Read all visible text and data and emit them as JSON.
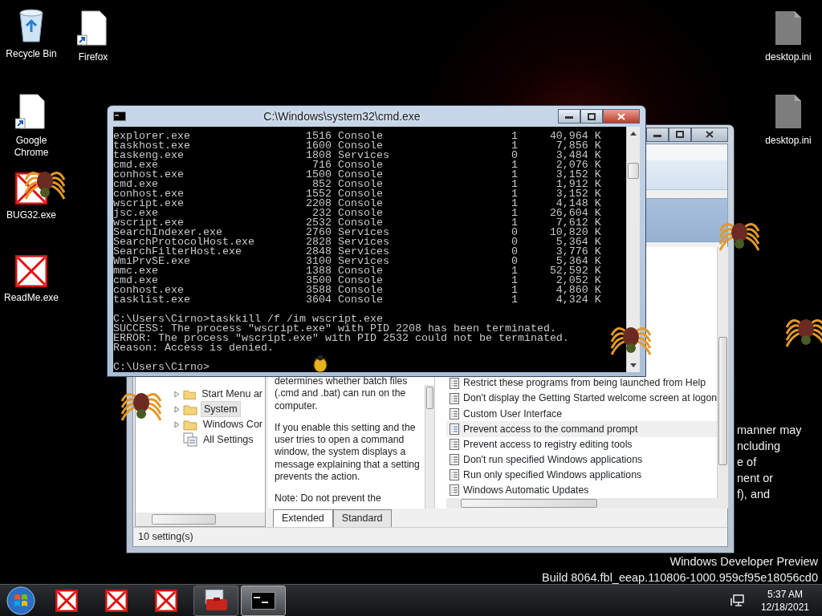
{
  "desktop_icons": [
    {
      "label": "Recycle Bin",
      "kind": "recycle"
    },
    {
      "label": "Firefox",
      "kind": "shortcut"
    },
    {
      "label": "Google Chrome",
      "kind": "shortcut"
    },
    {
      "label": "BUG32.exe",
      "kind": "denied"
    },
    {
      "label": "ReadMe.exe",
      "kind": "denied"
    },
    {
      "label": "desktop.ini",
      "kind": "file"
    },
    {
      "label": "desktop.ini",
      "kind": "file"
    }
  ],
  "console_window": {
    "title": "C:\\Windows\\system32\\cmd.exe",
    "lines": [
      {
        "kind": "process",
        "image": "explorer.exe",
        "pid": "1516",
        "session": "Console",
        "session_no": "1",
        "mem": "40,964 K"
      },
      {
        "kind": "process",
        "image": "taskhost.exe",
        "pid": "1600",
        "session": "Console",
        "session_no": "1",
        "mem": "7,856 K"
      },
      {
        "kind": "process",
        "image": "taskeng.exe",
        "pid": "1808",
        "session": "Services",
        "session_no": "0",
        "mem": "3,484 K"
      },
      {
        "kind": "process",
        "image": "cmd.exe",
        "pid": "716",
        "session": "Console",
        "session_no": "1",
        "mem": "2,076 K"
      },
      {
        "kind": "process",
        "image": "conhost.exe",
        "pid": "1500",
        "session": "Console",
        "session_no": "1",
        "mem": "3,152 K"
      },
      {
        "kind": "process",
        "image": "cmd.exe",
        "pid": "852",
        "session": "Console",
        "session_no": "1",
        "mem": "1,912 K"
      },
      {
        "kind": "process",
        "image": "conhost.exe",
        "pid": "1552",
        "session": "Console",
        "session_no": "1",
        "mem": "3,152 K"
      },
      {
        "kind": "process",
        "image": "wscript.exe",
        "pid": "2208",
        "session": "Console",
        "session_no": "1",
        "mem": "4,148 K"
      },
      {
        "kind": "process",
        "image": "jsc.exe",
        "pid": "232",
        "session": "Console",
        "session_no": "1",
        "mem": "26,604 K"
      },
      {
        "kind": "process",
        "image": "wscript.exe",
        "pid": "2532",
        "session": "Console",
        "session_no": "1",
        "mem": "7,612 K"
      },
      {
        "kind": "process",
        "image": "SearchIndexer.exe",
        "pid": "2760",
        "session": "Services",
        "session_no": "0",
        "mem": "10,820 K"
      },
      {
        "kind": "process",
        "image": "SearchProtocolHost.exe",
        "pid": "2828",
        "session": "Services",
        "session_no": "0",
        "mem": "5,364 K"
      },
      {
        "kind": "process",
        "image": "SearchFilterHost.exe",
        "pid": "2848",
        "session": "Services",
        "session_no": "0",
        "mem": "3,776 K"
      },
      {
        "kind": "process",
        "image": "WmiPrvSE.exe",
        "pid": "3100",
        "session": "Services",
        "session_no": "0",
        "mem": "5,364 K"
      },
      {
        "kind": "process",
        "image": "mmc.exe",
        "pid": "1388",
        "session": "Console",
        "session_no": "1",
        "mem": "52,592 K"
      },
      {
        "kind": "process",
        "image": "cmd.exe",
        "pid": "3500",
        "session": "Console",
        "session_no": "1",
        "mem": "2,052 K"
      },
      {
        "kind": "process",
        "image": "conhost.exe",
        "pid": "3588",
        "session": "Console",
        "session_no": "1",
        "mem": "4,860 K"
      },
      {
        "kind": "process",
        "image": "tasklist.exe",
        "pid": "3604",
        "session": "Console",
        "session_no": "1",
        "mem": "4,324 K"
      },
      {
        "kind": "blank"
      },
      {
        "kind": "text",
        "text": "C:\\Users\\Cirno>taskkill /f /im wscript.exe"
      },
      {
        "kind": "text",
        "text": "SUCCESS: The process \"wscript.exe\" with PID 2208 has been terminated."
      },
      {
        "kind": "text",
        "text": "ERROR: The process \"wscript.exe\" with PID 2532 could not be terminated."
      },
      {
        "kind": "text",
        "text": "Reason: Access is denied."
      },
      {
        "kind": "blank"
      },
      {
        "kind": "text",
        "text": "C:\\Users\\Cirno>"
      }
    ]
  },
  "policy_window": {
    "tree": [
      {
        "label": "Start Menu ar",
        "kind": "folder",
        "selected": false
      },
      {
        "label": "System",
        "kind": "folder",
        "selected": true
      },
      {
        "label": "Windows Cor",
        "kind": "folder",
        "selected": false
      },
      {
        "label": "All Settings",
        "kind": "settings",
        "selected": false
      }
    ],
    "description": [
      "determines whether batch files (.cmd and .bat) can run on the computer.",
      "If you enable this setting and the user tries to open a command window, the system displays a message explaining that a setting prevents the action.",
      "Note: Do not prevent the"
    ],
    "settings": [
      {
        "label": "Restrict these programs from being launched from Help",
        "selected": false
      },
      {
        "label": "Don't display the Getting Started welcome screen at logon",
        "selected": false
      },
      {
        "label": "Custom User Interface",
        "selected": false
      },
      {
        "label": "Prevent access to the command prompt",
        "selected": true
      },
      {
        "label": "Prevent access to registry editing tools",
        "selected": false
      },
      {
        "label": "Don't run specified Windows applications",
        "selected": false
      },
      {
        "label": "Run only specified Windows applications",
        "selected": false
      },
      {
        "label": "Windows Automatic Updates",
        "selected": false
      }
    ],
    "tabs": [
      {
        "label": "Extended",
        "selected": true
      },
      {
        "label": "Standard",
        "selected": false
      }
    ],
    "status": "10 setting(s)"
  },
  "background_text": [
    "manner may",
    "ncluding",
    "e of",
    "nent or",
    "f), and"
  ],
  "build_info": [
    "Windows Developer Preview",
    "Build 8064.fbl_eeap.110806-1000.959cf95e18056cd0"
  ],
  "taskbar": {
    "buttons": [
      {
        "kind": "denied",
        "active": false
      },
      {
        "kind": "denied",
        "active": false
      },
      {
        "kind": "denied",
        "active": false
      },
      {
        "kind": "toolbox",
        "active": false
      },
      {
        "kind": "console",
        "active": true
      }
    ],
    "time": "5:37 AM",
    "date": "12/18/2021"
  }
}
